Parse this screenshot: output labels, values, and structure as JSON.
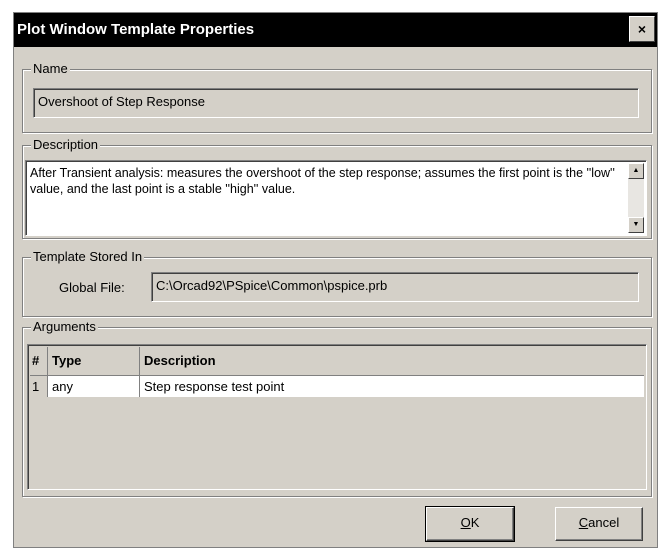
{
  "window": {
    "title": "Plot Window Template Properties",
    "close_glyph": "×"
  },
  "name_group": {
    "legend": "Name",
    "value": "Overshoot of Step Response"
  },
  "description_group": {
    "legend": "Description",
    "text": "After Transient analysis: measures the overshoot of the step response; assumes the first point is the ''low'' value, and the last point is a stable ''high'' value."
  },
  "stored_group": {
    "legend": "Template Stored In",
    "global_file_label": "Global File:",
    "global_file_value": "C:\\Orcad92\\PSpice\\Common\\pspice.prb"
  },
  "arguments_group": {
    "legend": "Arguments",
    "columns": [
      "#",
      "Type",
      "Description"
    ],
    "rows": [
      {
        "num": "1",
        "type": "any",
        "description": "Step response test point"
      }
    ]
  },
  "buttons": {
    "ok": {
      "mnemonic": "O",
      "rest": "K"
    },
    "cancel": {
      "mnemonic": "C",
      "rest": "ancel"
    }
  }
}
